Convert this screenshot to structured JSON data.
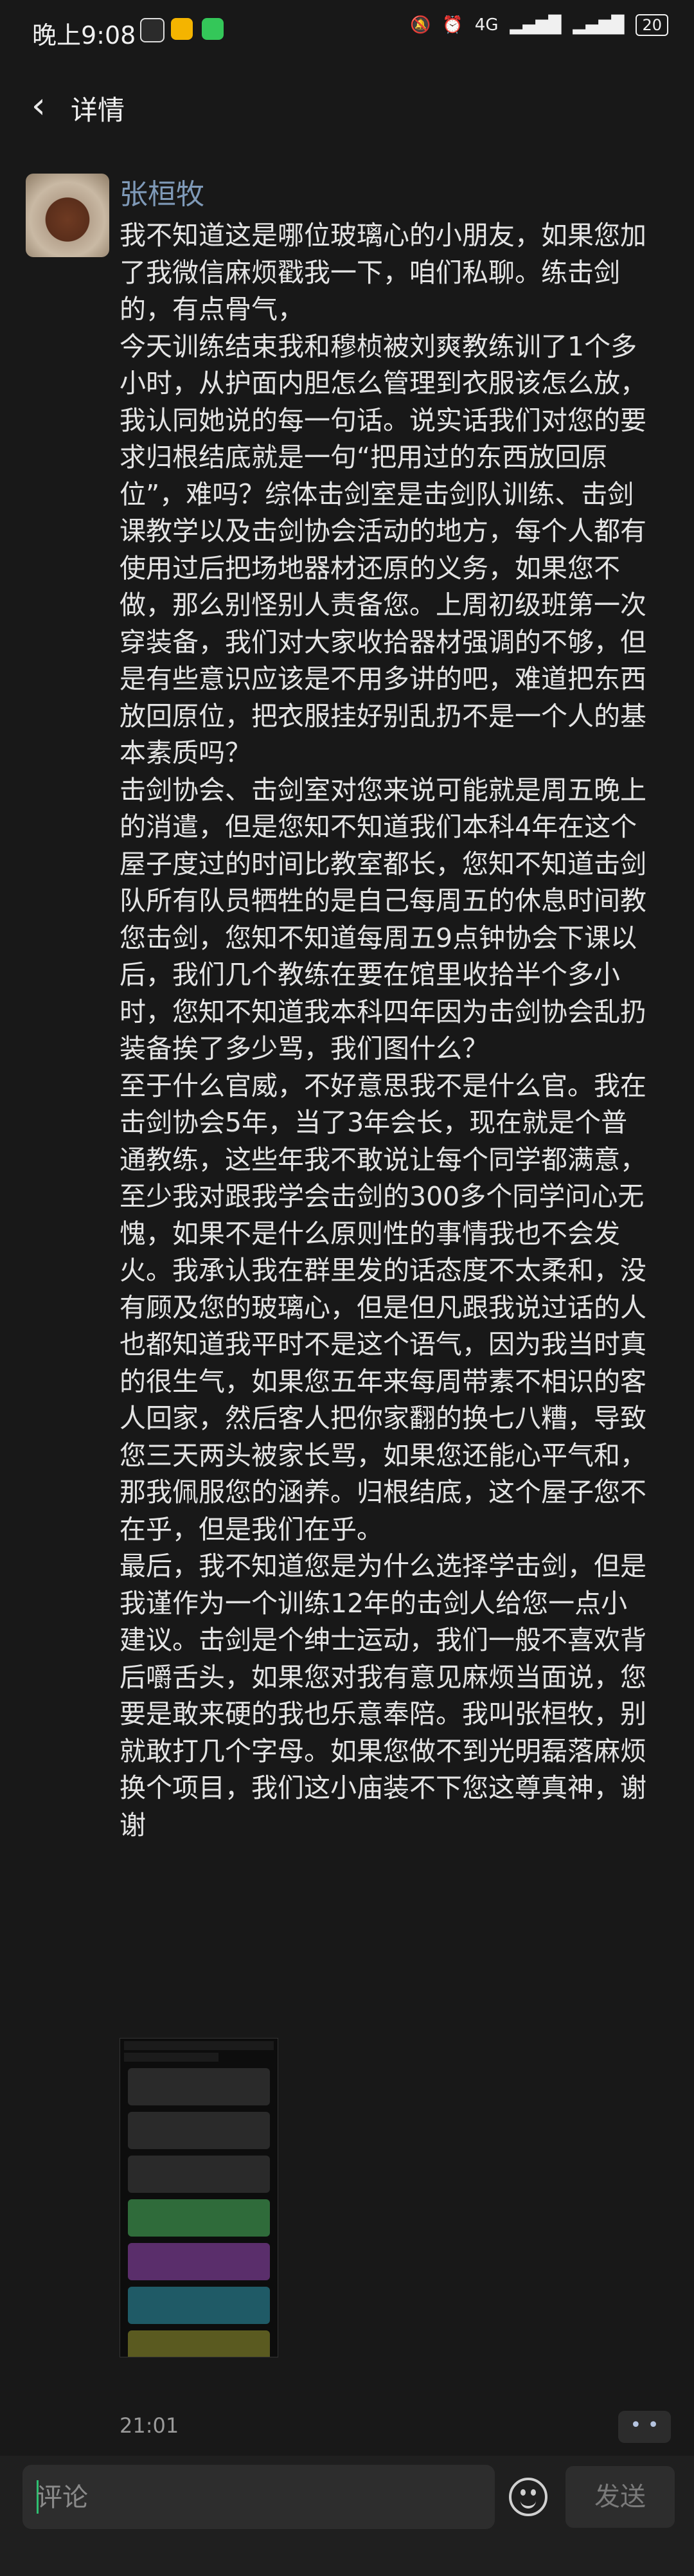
{
  "status_bar": {
    "time": "晚上9:08",
    "network": "4G",
    "battery": "20"
  },
  "nav": {
    "back_icon": "chevron-left-icon",
    "title": "详情"
  },
  "post": {
    "author": "张桓牧",
    "paragraphs": [
      "我不知道这是哪位玻璃心的小朋友，如果您加了我微信麻烦戳我一下，咱们私聊。练击剑的，有点骨气，",
      "今天训练结束我和穆桢被刘爽教练训了1个多小时，从护面内胆怎么管理到衣服该怎么放，我认同她说的每一句话。说实话我们对您的要求归根结底就是一句“把用过的东西放回原位”，难吗？综体击剑室是击剑队训练、击剑课教学以及击剑协会活动的地方，每个人都有使用过后把场地器材还原的义务，如果您不做，那么别怪别人责备您。上周初级班第一次穿装备，我们对大家收拾器材强调的不够，但是有些意识应该是不用多讲的吧，难道把东西放回原位，把衣服挂好别乱扔不是一个人的基本素质吗？",
      "击剑协会、击剑室对您来说可能就是周五晚上的消遣，但是您知不知道我们本科4年在这个屋子度过的时间比教室都长，您知不知道击剑队所有队员牺牲的是自己每周五的休息时间教您击剑，您知不知道每周五9点钟协会下课以后，我们几个教练在要在馆里收拾半个多小时，您知不知道我本科四年因为击剑协会乱扔装备挨了多少骂，我们图什么？",
      "至于什么官威，不好意思我不是什么官。我在击剑协会5年，当了3年会长，现在就是个普通教练，这些年我不敢说让每个同学都满意，至少我对跟我学会击剑的300多个同学问心无愧，如果不是什么原则性的事情我也不会发火。我承认我在群里发的话态度不太柔和，没有顾及您的玻璃心，但是但凡跟我说过话的人也都知道我平时不是这个语气，因为我当时真的很生气，如果您五年来每周带素不相识的客人回家，然后客人把你家翻的换七八糟，导致您三天两头被家长骂，如果您还能心平气和，那我佩服您的涵养。归根结底，这个屋子您不在乎，但是我们在乎。",
      "最后，我不知道您是为什么选择学击剑，但是我谨作为一个训练12年的击剑人给您一点小建议。击剑是个绅士运动，我们一般不喜欢背后嚼舌头，如果您对我有意见麻烦当面说，您要是敢来硬的我也乐意奉陪。我叫张桓牧，别就敢打几个字母。如果您做不到光明磊落麻烦换个项目，我们这小庙装不下您这尊真神，谢谢"
    ],
    "time": "21:01",
    "more_icon": "more-dots-icon"
  },
  "footer": {
    "comment_placeholder": "评论",
    "emoji_icon": "emoji-icon",
    "send_label": "发送"
  },
  "colors": {
    "background": "#181818",
    "author": "#7f9ab8",
    "text": "#e4e4e4"
  }
}
